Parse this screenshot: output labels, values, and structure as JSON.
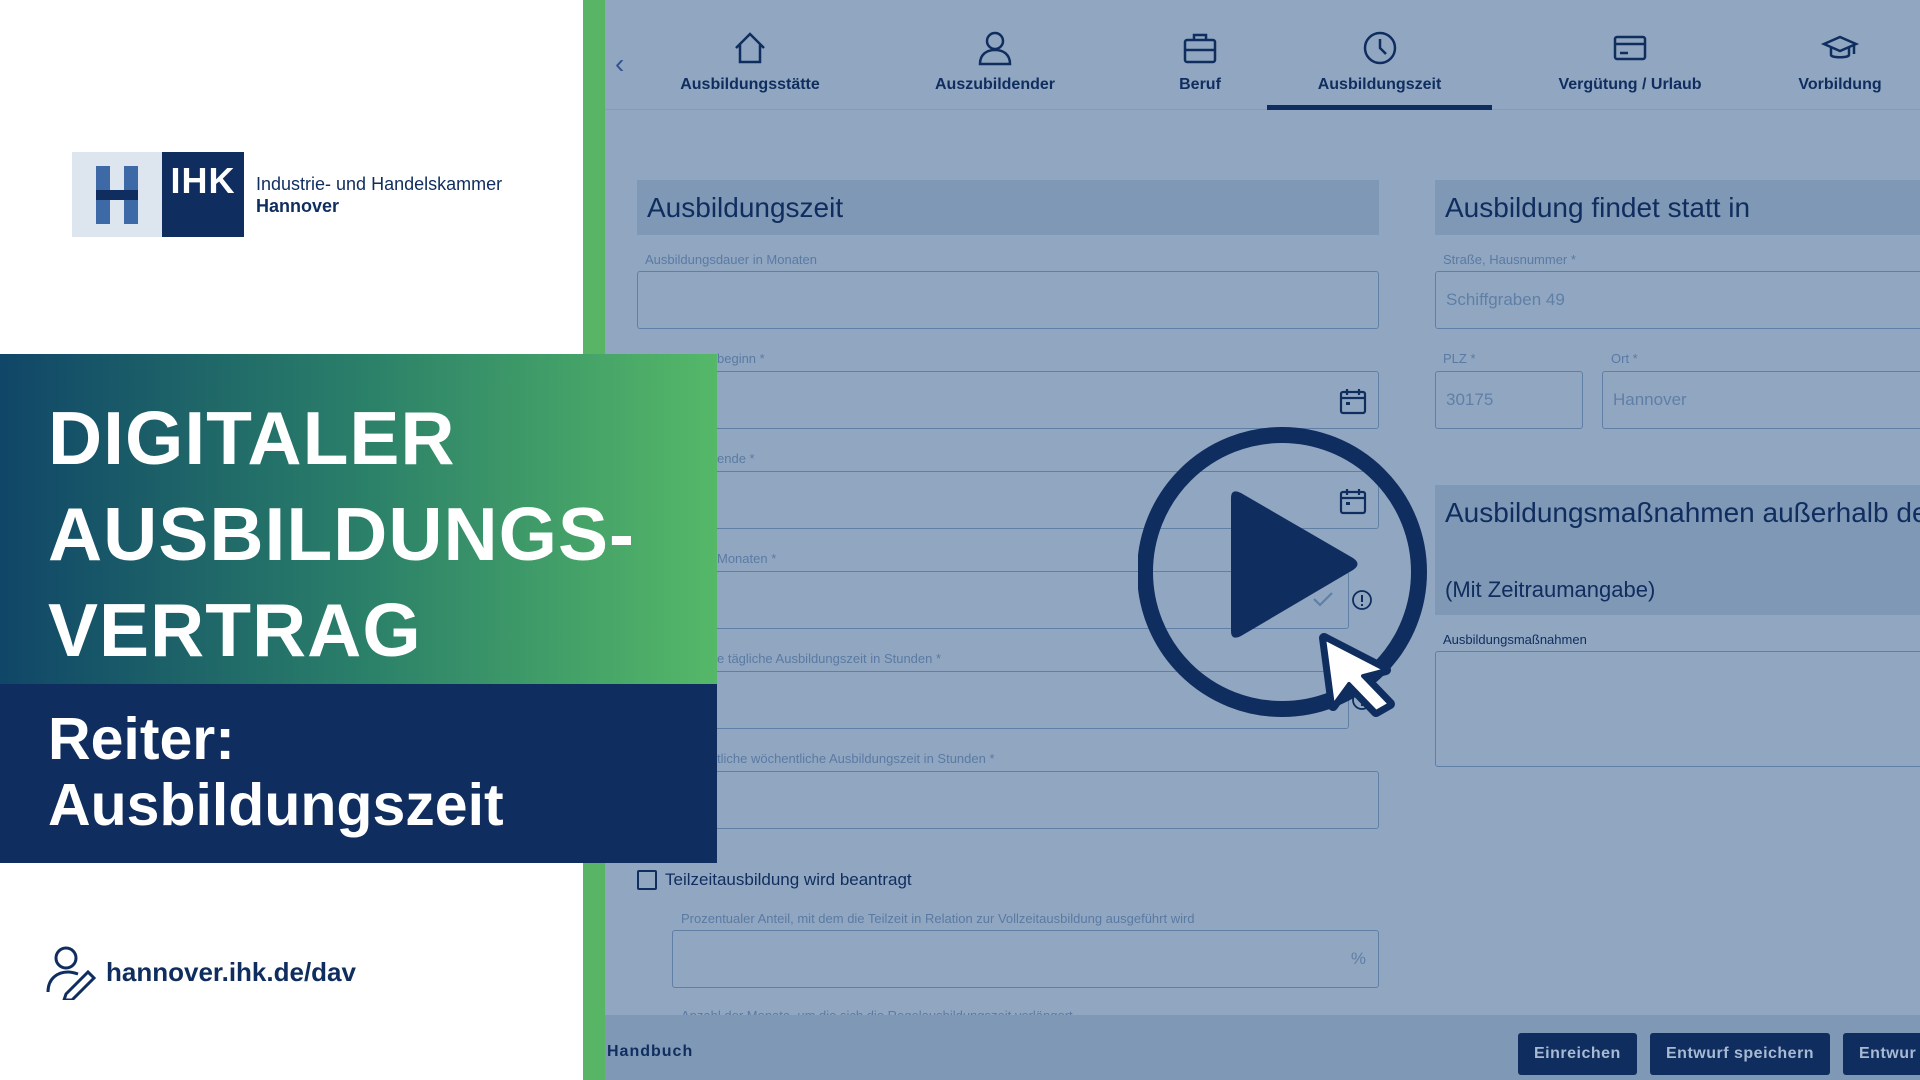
{
  "brand": {
    "logo_ihk": "IHK",
    "logo_line1": "Industrie- und Handelskammer",
    "logo_line2": "Hannover",
    "title_lines": [
      "DIGITALER",
      "AUSBILDUNGS-",
      "VERTRAG"
    ],
    "subtitle_lines": [
      "Reiter:",
      "Ausbildungszeit"
    ],
    "link": "hannover.ihk.de/dav",
    "colors": {
      "navy": "#0f2d5e",
      "green": "#57b565",
      "overlay": "#91a7c1"
    }
  },
  "tabs": [
    {
      "label": "Ausbildungsstätte",
      "icon": "home-icon"
    },
    {
      "label": "Auszubildender",
      "icon": "person-icon"
    },
    {
      "label": "Beruf",
      "icon": "briefcase-icon"
    },
    {
      "label": "Ausbildungszeit",
      "icon": "clock-icon",
      "active": true
    },
    {
      "label": "Vergütung / Urlaub",
      "icon": "card-icon"
    },
    {
      "label": "Vorbildung",
      "icon": "graduation-cap-icon"
    }
  ],
  "left_section": {
    "header": "Ausbildungszeit",
    "fields": [
      {
        "label": "Ausbildungsdauer in Monaten",
        "value": ""
      },
      {
        "label": "beginn *",
        "value": ""
      },
      {
        "label": "ende *",
        "value": ""
      },
      {
        "label": "Monaten *",
        "value": ""
      },
      {
        "label": "e tägliche Ausbildungszeit in Stunden *",
        "value": ""
      },
      {
        "label": "tliche wöchentliche Ausbildungszeit in Stunden *",
        "value": ""
      }
    ],
    "checkbox_label": "Teilzeitausbildung wird beantragt",
    "percent_label": "Prozentualer Anteil, mit dem die Teilzeit in Relation zur Vollzeitausbildung ausgeführt wird",
    "percent_suffix": "%",
    "cut_label": "Anzahl der Monate, um die sich die Regelausbildungszeit verlängert"
  },
  "right_section": {
    "header": "Ausbildung findet statt in",
    "street_label": "Straße, Hausnummer *",
    "street_value": "Schiffgraben 49",
    "plz_label": "PLZ *",
    "plz_value": "30175",
    "ort_label": "Ort *",
    "ort_value": "Hannover",
    "measures_header": "Ausbildungsmaßnahmen außerhalb der",
    "measures_sub": "(Mit Zeitraumangabe)",
    "measures_label": "Ausbildungsmaßnahmen"
  },
  "footer": {
    "handbuch": "Handbuch",
    "submit": "Einreichen",
    "save_draft": "Entwurf speichern",
    "draft_cut": "Entwur"
  }
}
